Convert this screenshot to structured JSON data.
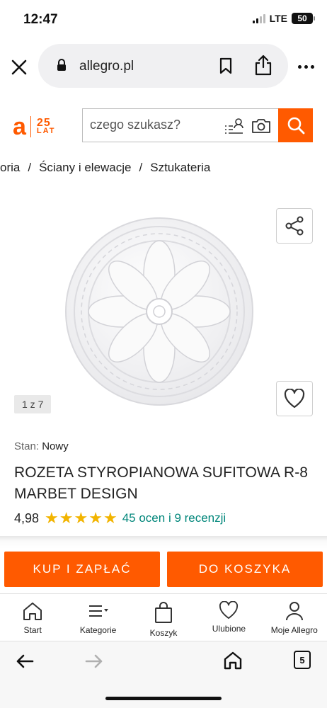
{
  "status_bar": {
    "time": "12:47",
    "network": "LTE",
    "battery": "50"
  },
  "browser": {
    "url": "allegro.pl"
  },
  "header": {
    "logo_letter": "a",
    "anniversary_number": "25",
    "anniversary_text": "LAT",
    "search_placeholder": "czego szukasz?",
    "brand_color": "#ff5a00"
  },
  "breadcrumb": [
    "oria",
    "Ściany i elewacje",
    "Sztukateria"
  ],
  "gallery": {
    "counter": "1 z 7"
  },
  "product": {
    "condition_label": "Stan:",
    "condition_value": "Nowy",
    "title": "ROZETA STYROPIANOWA SUFITOWA R-8 MARBET DESIGN",
    "rating": "4,98",
    "stars": 5,
    "reviews": "45 ocen i 9 recenzji",
    "rating_color": "#00867a"
  },
  "actions": {
    "buy_label": "KUP I ZAPŁAĆ",
    "cart_label": "DO KOSZYKA"
  },
  "bottom_nav": [
    {
      "label": "Start",
      "icon": "home-icon"
    },
    {
      "label": "Kategorie",
      "icon": "menu-icon"
    },
    {
      "label": "Koszyk",
      "icon": "bag-icon"
    },
    {
      "label": "Ulubione",
      "icon": "heart-icon"
    },
    {
      "label": "Moje Allegro",
      "icon": "user-icon"
    }
  ],
  "toolbar": {
    "tab_count": "5"
  }
}
